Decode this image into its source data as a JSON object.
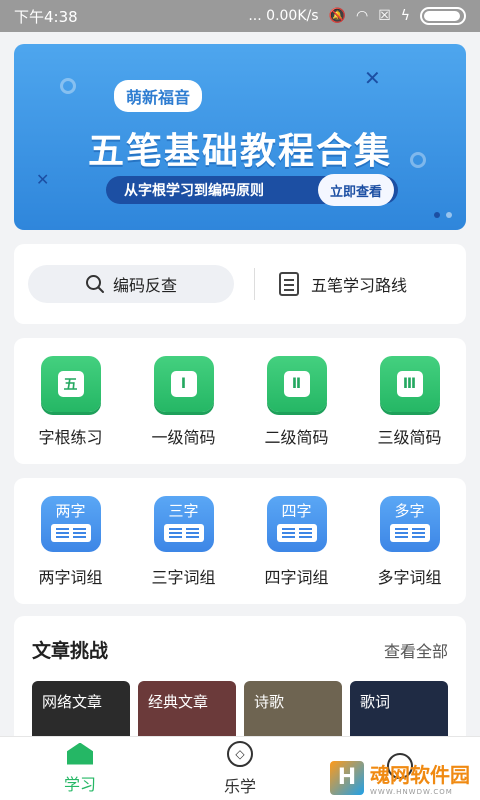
{
  "status_bar": {
    "time": "下午4:38",
    "network": "... 0.00K/s"
  },
  "banner": {
    "tag": "萌新福音",
    "title": "五笔基础教程合集",
    "subtitle": "从字根学习到编码原则",
    "button": "立即查看"
  },
  "search": {
    "lookup_label": "编码反查",
    "route_label": "五笔学习路线"
  },
  "practice_grid": [
    {
      "icon_text": "五",
      "label": "字根练习"
    },
    {
      "icon_text": "Ⅰ",
      "label": "一级简码"
    },
    {
      "icon_text": "Ⅱ",
      "label": "二级简码"
    },
    {
      "icon_text": "Ⅲ",
      "label": "三级简码"
    }
  ],
  "phrase_grid": [
    {
      "icon_text": "两字",
      "label": "两字词组"
    },
    {
      "icon_text": "三字",
      "label": "三字词组"
    },
    {
      "icon_text": "四字",
      "label": "四字词组"
    },
    {
      "icon_text": "多字",
      "label": "多字词组"
    }
  ],
  "articles": {
    "title": "文章挑战",
    "more": "查看全部",
    "items": [
      {
        "label": "网络文章",
        "color": "#2b2b2b"
      },
      {
        "label": "经典文章",
        "color": "#6b3a3a"
      },
      {
        "label": "诗歌",
        "color": "#6e6451"
      },
      {
        "label": "歌词",
        "color": "#1f2b44"
      }
    ]
  },
  "tabs": [
    {
      "label": "学习",
      "icon": "home-icon"
    },
    {
      "label": "乐学",
      "icon": "compass-icon"
    },
    {
      "label": "",
      "icon": "profile-icon"
    }
  ],
  "watermark": {
    "cn": "魂网软件园",
    "en": "WWW.HNWDW.COM",
    "logo": "H"
  },
  "colors": {
    "accent_green": "#25b765",
    "banner_blue": "#2f86db",
    "tile_blue": "#3d86e6"
  }
}
